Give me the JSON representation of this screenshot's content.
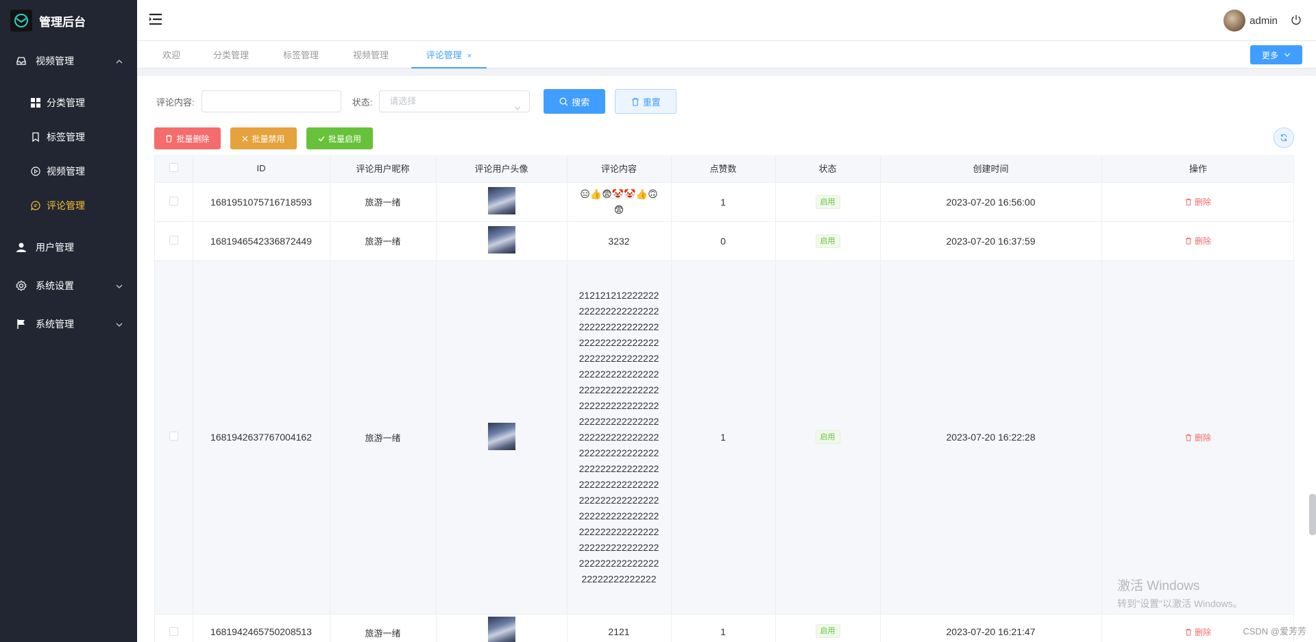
{
  "app": {
    "title": "管理后台"
  },
  "sidebar": {
    "items": [
      {
        "label": "视频管理",
        "icon": "inbox-icon"
      },
      {
        "label": "用户管理",
        "icon": "user-icon"
      },
      {
        "label": "系统设置",
        "icon": "gear-icon"
      },
      {
        "label": "系统管理",
        "icon": "flag-icon"
      }
    ],
    "submenu": [
      {
        "label": "分类管理",
        "icon": "grid-icon"
      },
      {
        "label": "标签管理",
        "icon": "bookmark-icon"
      },
      {
        "label": "视频管理",
        "icon": "play-circle-icon"
      },
      {
        "label": "评论管理",
        "icon": "chat-icon"
      }
    ]
  },
  "header": {
    "username": "admin"
  },
  "tabs": [
    {
      "label": "欢迎"
    },
    {
      "label": "分类管理"
    },
    {
      "label": "标签管理"
    },
    {
      "label": "视频管理"
    },
    {
      "label": "评论管理",
      "close": "×"
    }
  ],
  "more_label": "更多",
  "filter": {
    "content_label": "评论内容:",
    "status_label": "状态:",
    "status_placeholder": "请选择",
    "search_label": "搜索",
    "reset_label": "重置"
  },
  "actions": {
    "batch_delete": "批量删除",
    "batch_disable": "批量禁用",
    "batch_enable": "批量启用"
  },
  "table": {
    "columns": [
      "ID",
      "评论用户昵称",
      "评论用户头像",
      "评论内容",
      "点赞数",
      "状态",
      "创建时间",
      "操作"
    ],
    "delete_label": "删除",
    "rows": [
      {
        "id": "1681951075716718593",
        "nickname": "旅游一绪",
        "content": "😑👍😨🤡🤡👍🙃😨",
        "likes": "1",
        "status": "启用",
        "created": "2023-07-20 16:56:00"
      },
      {
        "id": "1681946542336872449",
        "nickname": "旅游一绪",
        "content": "3232",
        "likes": "0",
        "status": "启用",
        "created": "2023-07-20 16:37:59"
      },
      {
        "id": "1681942637767004162",
        "nickname": "旅游一绪",
        "content": "21212121222222222222222222222222222222222222222222222222222222222222222222222222222222222222222222222222222222222222222222222222222222222222222222222222222222222222222222222222222222222222222222222222222222222222222222222222222222222222222222222222222222222222222222222222222222222222",
        "likes": "1",
        "status": "启用",
        "created": "2023-07-20 16:22:28"
      },
      {
        "id": "1681942465750208513",
        "nickname": "旅游一绪",
        "content": "2121",
        "likes": "1",
        "status": "启用",
        "created": "2023-07-20 16:21:47"
      }
    ]
  },
  "watermark": {
    "line1": "激活 Windows",
    "line2": "转到\"设置\"以激活 Windows。"
  },
  "credit": "CSDN @爱芳芳",
  "colors": {
    "sidebar_bg": "#222632",
    "accent": "#409eff",
    "active_menu": "#f5c034",
    "danger": "#f56c6c",
    "warning": "#e6a23c",
    "success": "#67c23a"
  }
}
